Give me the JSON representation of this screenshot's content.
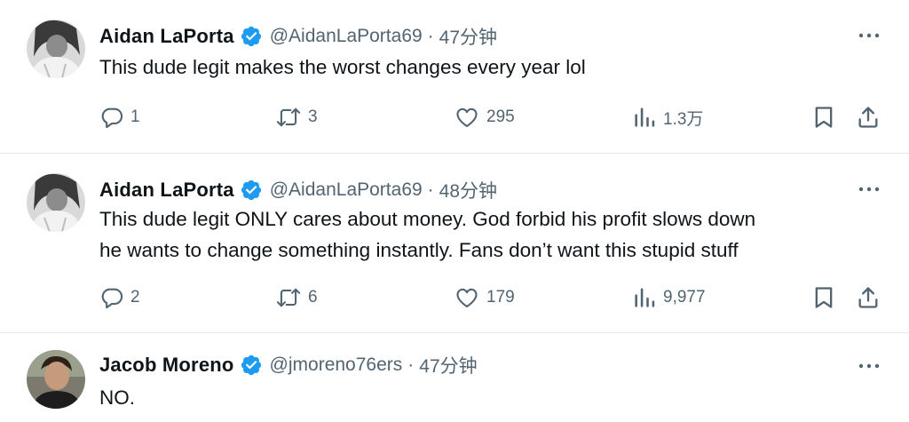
{
  "tweets": [
    {
      "name": "Aidan LaPorta",
      "handle": "@AidanLaPorta69",
      "separator": "·",
      "time": "47分钟",
      "lines": [
        "This dude legit makes the worst changes every year lol"
      ],
      "replies": "1",
      "retweets": "3",
      "likes": "295",
      "views": "1.3万"
    },
    {
      "name": "Aidan LaPorta",
      "handle": "@AidanLaPorta69",
      "separator": "·",
      "time": "48分钟",
      "lines": [
        "This dude legit ONLY cares about money. God forbid his profit slows down",
        "he wants to change something instantly. Fans don’t want this stupid stuff"
      ],
      "replies": "2",
      "retweets": "6",
      "likes": "179",
      "views": "9,977"
    },
    {
      "name": "Jacob Moreno",
      "handle": "@jmoreno76ers",
      "separator": "·",
      "time": "47分钟",
      "lines": [
        "NO."
      ]
    }
  ],
  "icons": {
    "verified": "verified-badge-icon",
    "more": "more-dots-icon",
    "reply": "reply-bubble-icon",
    "retweet": "retweet-icon",
    "like": "heart-icon",
    "views": "views-bar-chart-icon",
    "bookmark": "bookmark-icon",
    "share": "share-icon"
  },
  "colors": {
    "verified": "#1d9bf0",
    "text": "#0f1419",
    "muted": "#536471",
    "divider": "#e6e9ea"
  }
}
